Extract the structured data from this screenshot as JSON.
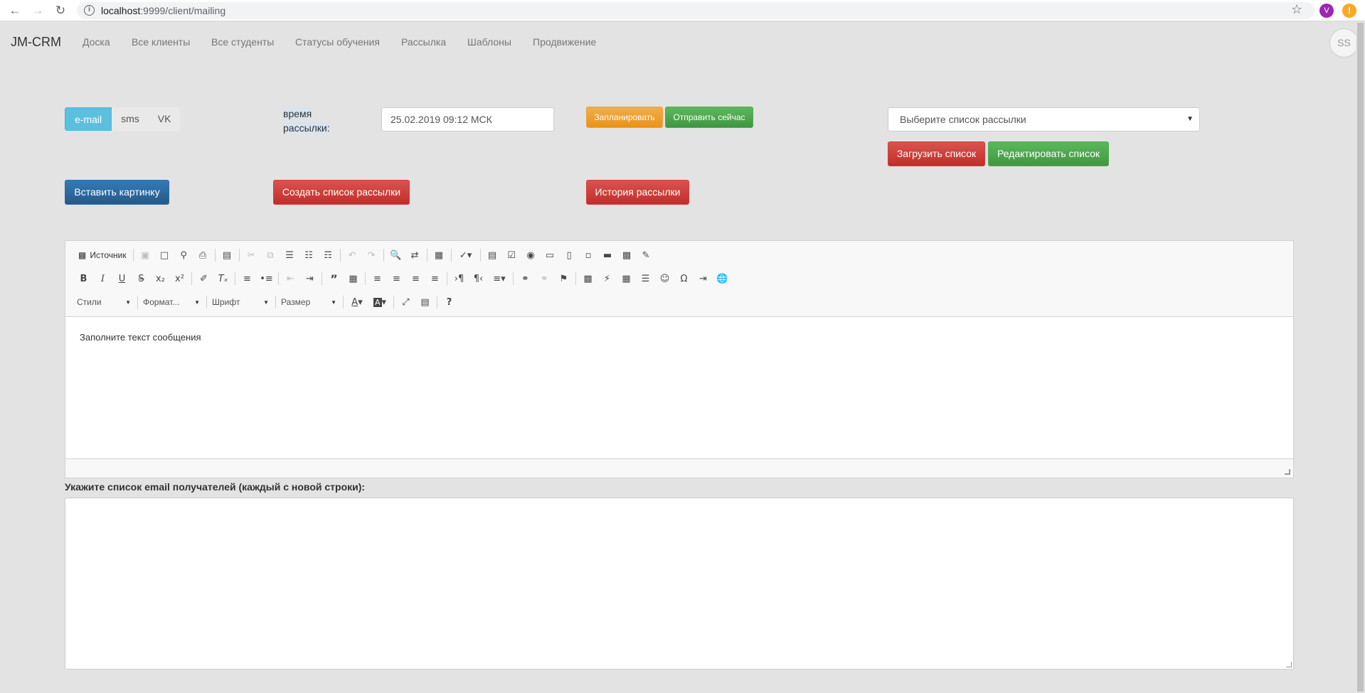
{
  "browser": {
    "url_host": "localhost",
    "url_rest": ":9999/client/mailing",
    "profile_initial": "V",
    "alert_symbol": "!"
  },
  "navbar": {
    "brand": "JM-CRM",
    "links": [
      "Доска",
      "Все клиенты",
      "Все студенты",
      "Статусы обучения",
      "Рассылка",
      "Шаблоны",
      "Продвижение"
    ],
    "avatar": "SS"
  },
  "channel": {
    "options": [
      "e-mail",
      "sms",
      "VK"
    ],
    "selected": "e-mail"
  },
  "schedule": {
    "label_line1": "время",
    "label_line2": "рассылки:",
    "datetime_value": "25.02.2019 09:12 МСК",
    "schedule_button": "Запланировать",
    "send_now_button": "Отправить сейчас"
  },
  "mailing_list": {
    "select_placeholder": "Выберите список рассылки",
    "upload_button": "Загрузить список",
    "edit_button": "Редактировать список"
  },
  "actions": {
    "insert_image": "Вставить картинку",
    "create_list": "Создать список рассылки",
    "history": "История рассылки"
  },
  "editor": {
    "source_label": "Источник",
    "combo_styles": "Стили",
    "combo_format": "Формат...",
    "combo_font": "Шрифт",
    "combo_size": "Размер",
    "body_text": "Заполните текст сообщения"
  },
  "recipients": {
    "label": "Укажите список email получателей (каждый с новой строки):",
    "value": ""
  },
  "colors": {
    "accent_info": "#5bc0de",
    "warning": "#f0ad4e",
    "success": "#5cb85c",
    "danger": "#d9534f",
    "primary": "#337ab7",
    "page_bg": "#e3e3e3"
  }
}
